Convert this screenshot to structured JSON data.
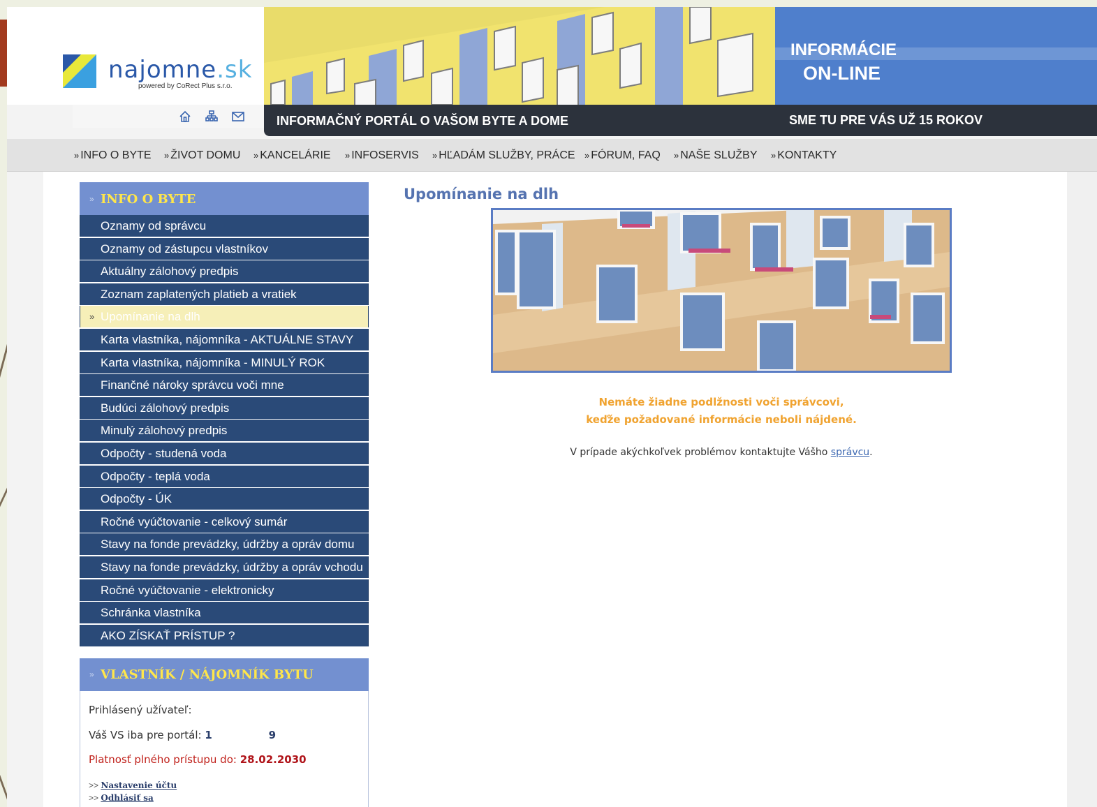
{
  "header": {
    "logo_main": "najomne",
    "logo_ext": ".sk",
    "logo_sub": "powered by CoRect Plus s.r.o.",
    "online_line1": "INFORMÁCIE",
    "online_line2": "ON-LINE",
    "portal_title": "INFORMAČNÝ PORTÁL O VAŠOM BYTE A DOME",
    "slogan": "SME TU PRE VÁS UŽ 15 ROKOV",
    "icons": [
      "home-icon",
      "sitemap-icon",
      "mail-icon"
    ]
  },
  "topnav": {
    "prefix": "»",
    "items": [
      "INFO O BYTE",
      "ŽIVOT DOMU",
      "KANCELÁRIE",
      "INFOSERVIS",
      "HĽADÁM SLUŽBY, PRÁCE",
      "FÓRUM, FAQ",
      "NAŠE SLUŽBY",
      "KONTAKTY"
    ]
  },
  "sidebar": {
    "title": "INFO O BYTE",
    "active_marker": "»",
    "items": [
      "Oznamy od správcu",
      "Oznamy od zástupcu vlastníkov",
      "Aktuálny zálohový predpis",
      "Zoznam zaplatených platieb a vratiek",
      "Upomínanie na dlh",
      "Karta vlastníka, nájomníka - AKTUÁLNE STAVY",
      "Karta vlastníka, nájomníka - MINULÝ ROK",
      "Finančné nároky správcu voči mne",
      "Budúci zálohový predpis",
      "Minulý zálohový predpis",
      "Odpočty - studená voda",
      "Odpočty - teplá voda",
      "Odpočty - ÚK",
      "Ročné vyúčtovanie - celkový sumár",
      "Stavy na fonde prevádzky, údržby a opráv domu",
      "Stavy na fonde prevádzky, údržby a opráv vchodu",
      "Ročné vyúčtovanie - elektronicky",
      "Schránka vlastníka",
      "AKO ZÍSKAŤ PRÍSTUP ?"
    ]
  },
  "owner": {
    "title": "VLASTNÍK / NÁJOMNÍK BYTU",
    "logged_label": "Prihlásený užívateľ:",
    "vs_label": "Váš VS iba pre portál:",
    "vs_value_a": "1",
    "vs_value_b": "9",
    "access_label": "Platnosť plného prístupu do:",
    "access_date": "28.02.2030",
    "link_marker": ">>",
    "link_settings": "Nastavenie účtu",
    "link_logout": "Odhlásiť sa"
  },
  "main": {
    "title": "Upomínanie na dlh",
    "message_line1": "Nemáte žiadne podlžnosti voči správcovi,",
    "message_line2": "keďže požadované informácie neboli nájdené.",
    "contact_text": "V prípade akýchkoľvek problémov kontaktujte Vášho",
    "contact_link": "správcu",
    "contact_end": "."
  },
  "colors": {
    "sidebar_item_bg": "#2a4a78",
    "sidebar_head_bg": "#7390d0",
    "sidebar_head_text": "#ffe64a",
    "active_item_bg": "#f6efb8",
    "message_color": "#f0a330",
    "title_color": "#5573b0",
    "portal_bar": "#2c323c",
    "online_box": "#4f7fcc"
  }
}
